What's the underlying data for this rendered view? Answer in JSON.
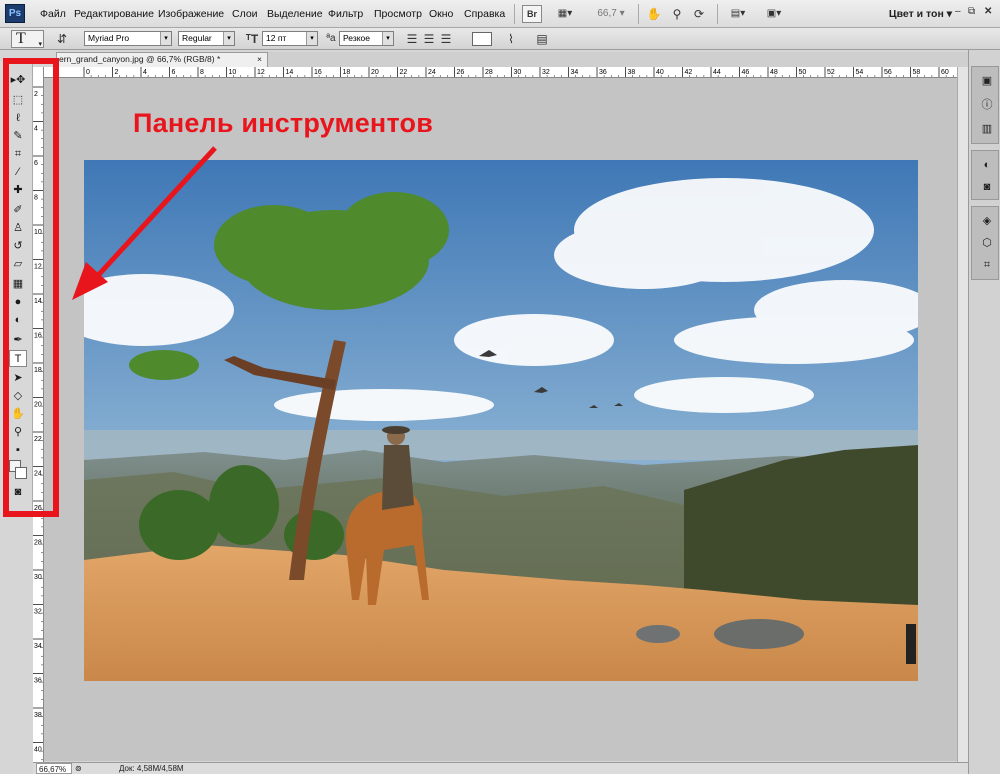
{
  "app": {
    "logo": "Ps"
  },
  "menubar": {
    "items": [
      "Файл",
      "Редактирование",
      "Изображение",
      "Слои",
      "Выделение",
      "Фильтр",
      "Просмотр",
      "Окно",
      "Справка"
    ],
    "bridge_label": "Br",
    "zoom_value": "66,7",
    "workspace": "Цвет и тон"
  },
  "options": {
    "font_family": "Myriad Pro",
    "font_style": "Regular",
    "font_size": "12 пт",
    "antialias": "Резкое"
  },
  "document": {
    "tab_title": "ern_grand_canyon.jpg @ 66,7% (RGB/8) *",
    "tab_close": "×"
  },
  "rulers": {
    "top_labels": [
      "0",
      "2",
      "4",
      "6",
      "8",
      "10",
      "12",
      "14",
      "16",
      "18",
      "20",
      "22",
      "24",
      "26",
      "28",
      "30",
      "32",
      "34",
      "36",
      "38",
      "40",
      "42",
      "44",
      "46",
      "48",
      "50",
      "52",
      "54",
      "56",
      "58",
      "60"
    ],
    "left_labels": [
      "2",
      "4",
      "6",
      "8",
      "10",
      "12",
      "14",
      "16",
      "18",
      "20",
      "22",
      "24",
      "26",
      "28",
      "30",
      "32",
      "34",
      "36",
      "38",
      "40"
    ]
  },
  "status": {
    "zoom": "66,67%",
    "doc_size": "Док: 4,58M/4,58M"
  },
  "annotation": {
    "text": "Панель инструментов",
    "color": "#e8161c"
  },
  "tools": [
    {
      "name": "move-tool",
      "icon": "▸✥"
    },
    {
      "name": "marquee-tool",
      "icon": "⬚"
    },
    {
      "name": "lasso-tool",
      "icon": "ℓ"
    },
    {
      "name": "quick-select-tool",
      "icon": "✎"
    },
    {
      "name": "crop-tool",
      "icon": "⌗"
    },
    {
      "name": "eyedropper-tool",
      "icon": "⁄"
    },
    {
      "name": "healing-brush-tool",
      "icon": "✚"
    },
    {
      "name": "brush-tool",
      "icon": "✐"
    },
    {
      "name": "clone-stamp-tool",
      "icon": "♙"
    },
    {
      "name": "history-brush-tool",
      "icon": "↺"
    },
    {
      "name": "eraser-tool",
      "icon": "▱"
    },
    {
      "name": "gradient-tool",
      "icon": "▦"
    },
    {
      "name": "blur-tool",
      "icon": "●"
    },
    {
      "name": "dodge-tool",
      "icon": "◐"
    },
    {
      "name": "pen-tool",
      "icon": "✒"
    },
    {
      "name": "type-tool",
      "icon": "T",
      "selected": true
    },
    {
      "name": "path-select-tool",
      "icon": "➤"
    },
    {
      "name": "shape-tool",
      "icon": "◇"
    },
    {
      "name": "hand-tool",
      "icon": "✋"
    },
    {
      "name": "zoom-tool",
      "icon": "⚲"
    },
    {
      "name": "default-colors-icon",
      "icon": "▪"
    },
    {
      "name": "color-swatches",
      "icon": ""
    },
    {
      "name": "quick-mask-tool",
      "icon": "◙"
    }
  ],
  "colors": {
    "accent_red": "#e8161c",
    "ps_blue": "#1d3c6e",
    "canvas_gray": "#c4c4c4"
  }
}
